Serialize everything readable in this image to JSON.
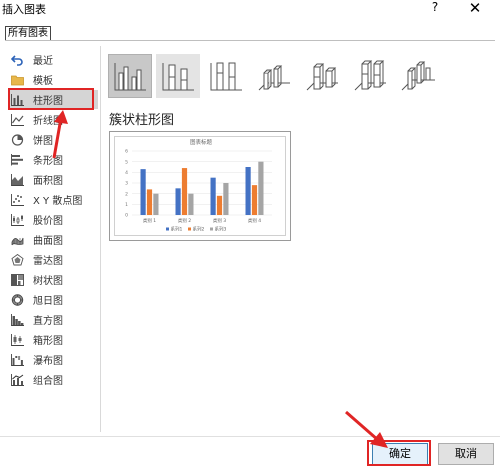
{
  "dialog": {
    "title": "插入图表",
    "help": "?",
    "close": "✕"
  },
  "tab": {
    "label": "所有图表"
  },
  "sidebar": {
    "items": [
      {
        "label": "最近",
        "icon": "undo-arrow-icon"
      },
      {
        "label": "模板",
        "icon": "folder-icon"
      },
      {
        "label": "柱形图",
        "icon": "column-chart-icon",
        "selected": true
      },
      {
        "label": "折线图",
        "icon": "line-chart-icon"
      },
      {
        "label": "饼图",
        "icon": "pie-chart-icon"
      },
      {
        "label": "条形图",
        "icon": "bar-chart-icon"
      },
      {
        "label": "面积图",
        "icon": "area-chart-icon"
      },
      {
        "label": "X Y 散点图",
        "icon": "scatter-chart-icon"
      },
      {
        "label": "股价图",
        "icon": "stock-chart-icon"
      },
      {
        "label": "曲面图",
        "icon": "surface-chart-icon"
      },
      {
        "label": "雷达图",
        "icon": "radar-chart-icon"
      },
      {
        "label": "树状图",
        "icon": "treemap-chart-icon"
      },
      {
        "label": "旭日图",
        "icon": "sunburst-chart-icon"
      },
      {
        "label": "直方图",
        "icon": "histogram-chart-icon"
      },
      {
        "label": "箱形图",
        "icon": "box-whisker-chart-icon"
      },
      {
        "label": "瀑布图",
        "icon": "waterfall-chart-icon"
      },
      {
        "label": "组合图",
        "icon": "combo-chart-icon"
      }
    ]
  },
  "subtypes": {
    "section_title": "簇状柱形图",
    "items": [
      {
        "name": "clustered-column",
        "selected": true
      },
      {
        "name": "stacked-column"
      },
      {
        "name": "percent-stacked-column"
      },
      {
        "name": "3d-clustered-column"
      },
      {
        "name": "3d-stacked-column"
      },
      {
        "name": "3d-percent-stacked-column"
      },
      {
        "name": "3d-column"
      }
    ]
  },
  "preview": {
    "chart_title": "图表标题",
    "y_ticks": [
      "6",
      "5",
      "4",
      "3",
      "2",
      "1",
      "0"
    ],
    "categories": [
      "类别 1",
      "类别 2",
      "类别 3",
      "类别 4"
    ],
    "series_names": [
      "系列1",
      "系列2",
      "系列3"
    ],
    "colors": [
      "#4472c4",
      "#ed7d31",
      "#a5a5a5"
    ]
  },
  "chart_data": {
    "type": "bar",
    "title": "图表标题",
    "categories": [
      "类别 1",
      "类别 2",
      "类别 3",
      "类别 4"
    ],
    "series": [
      {
        "name": "系列1",
        "values": [
          4.3,
          2.5,
          3.5,
          4.5
        ]
      },
      {
        "name": "系列2",
        "values": [
          2.4,
          4.4,
          1.8,
          2.8
        ]
      },
      {
        "name": "系列3",
        "values": [
          2.0,
          2.0,
          3.0,
          5.0
        ]
      }
    ],
    "ylim": [
      0,
      6
    ],
    "grid": true,
    "legend": "bottom"
  },
  "buttons": {
    "ok": "确定",
    "cancel": "取消"
  }
}
